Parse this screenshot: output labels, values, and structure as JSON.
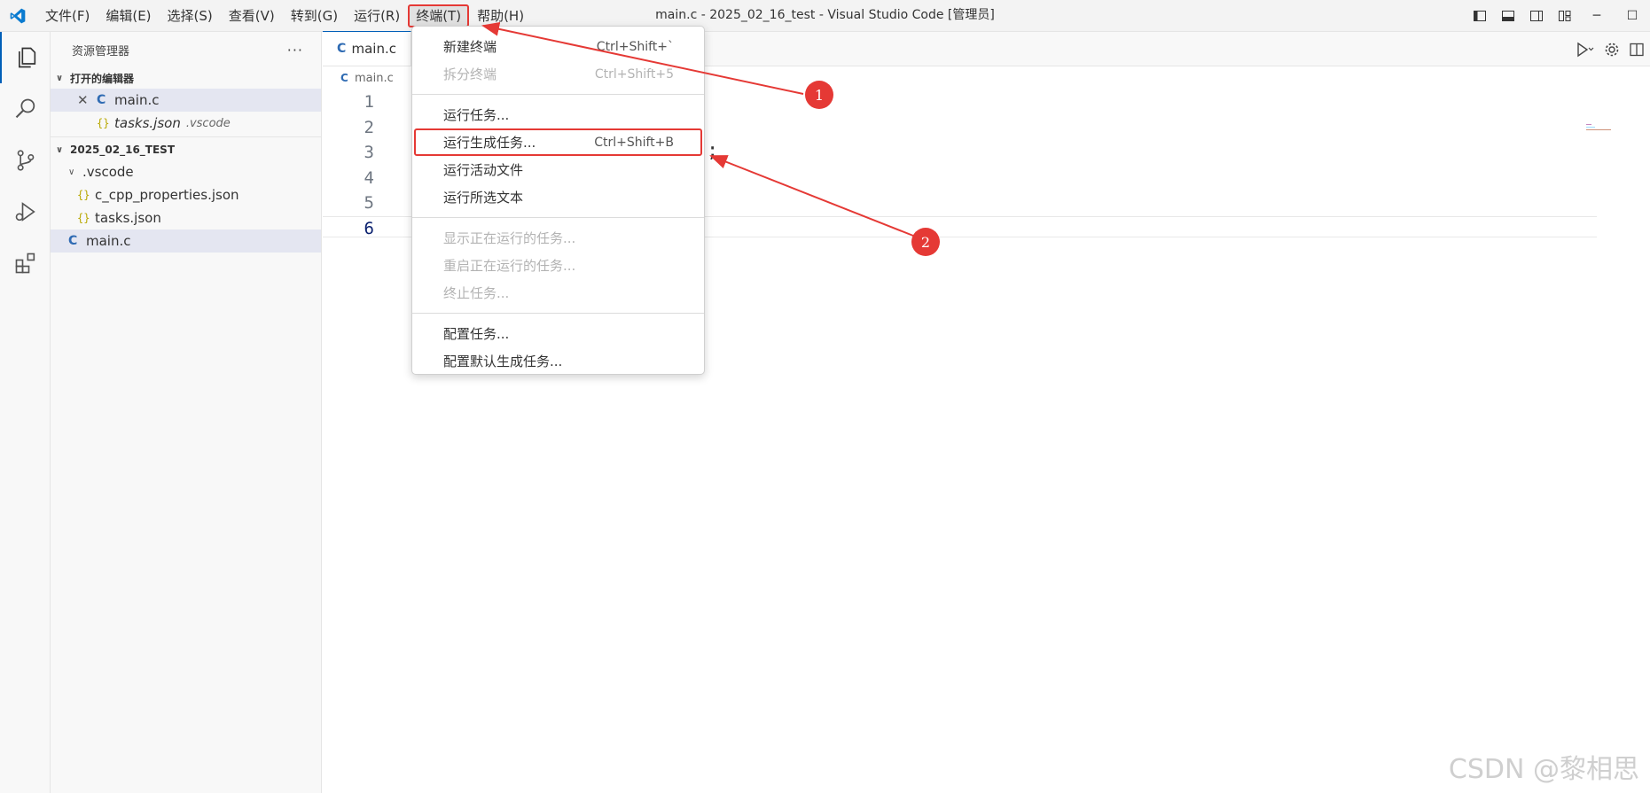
{
  "window": {
    "title": "main.c - 2025_02_16_test - Visual Studio Code [管理员]"
  },
  "menubar": {
    "items": [
      "文件(F)",
      "编辑(E)",
      "选择(S)",
      "查看(V)",
      "转到(G)",
      "运行(R)",
      "终端(T)",
      "帮助(H)"
    ],
    "active": "终端(T)"
  },
  "window_controls": {
    "minimize": "─",
    "maximize": "☐"
  },
  "sidebar": {
    "header": "资源管理器",
    "more": "···",
    "open_editors_title": "打开的编辑器",
    "open_editors": [
      {
        "name": "main.c",
        "icon": "C",
        "selected": true
      },
      {
        "name": "tasks.json",
        "folder": ".vscode",
        "icon": "{}"
      }
    ],
    "workspace_title": "2025_02_16_TEST",
    "tree": [
      {
        "name": ".vscode",
        "type": "folder"
      },
      {
        "name": "c_cpp_properties.json",
        "icon": "{}"
      },
      {
        "name": "tasks.json",
        "icon": "{}"
      },
      {
        "name": "main.c",
        "icon": "C",
        "selected": true
      }
    ]
  },
  "editor": {
    "tab_label": "main.c",
    "tab_icon": "C",
    "breadcrumb": "main.c",
    "line_numbers": [
      "1",
      "2",
      "3",
      "4",
      "5",
      "6"
    ],
    "current_line": "6",
    "code_fragment": ";"
  },
  "terminal_menu": {
    "groups": [
      [
        {
          "label": "新建终端",
          "shortcut": "Ctrl+Shift+`",
          "enabled": true
        },
        {
          "label": "拆分终端",
          "shortcut": "Ctrl+Shift+5",
          "enabled": false
        }
      ],
      [
        {
          "label": "运行任务...",
          "shortcut": "",
          "enabled": true
        },
        {
          "label": "运行生成任务...",
          "shortcut": "Ctrl+Shift+B",
          "enabled": true,
          "highlighted": true
        },
        {
          "label": "运行活动文件",
          "shortcut": "",
          "enabled": true
        },
        {
          "label": "运行所选文本",
          "shortcut": "",
          "enabled": true
        }
      ],
      [
        {
          "label": "显示正在运行的任务...",
          "shortcut": "",
          "enabled": false
        },
        {
          "label": "重启正在运行的任务...",
          "shortcut": "",
          "enabled": false
        },
        {
          "label": "终止任务...",
          "shortcut": "",
          "enabled": false
        }
      ],
      [
        {
          "label": "配置任务...",
          "shortcut": "",
          "enabled": true
        },
        {
          "label": "配置默认生成任务...",
          "shortcut": "",
          "enabled": true
        }
      ]
    ]
  },
  "annotations": {
    "badge_1": "1",
    "badge_2": "2",
    "color": "#e53935"
  },
  "watermark": "CSDN @黎相思",
  "colors": {
    "accent": "#005fb8",
    "c_icon": "#2f6bb3",
    "json_icon": "#b8a800",
    "annotation": "#e53935"
  }
}
